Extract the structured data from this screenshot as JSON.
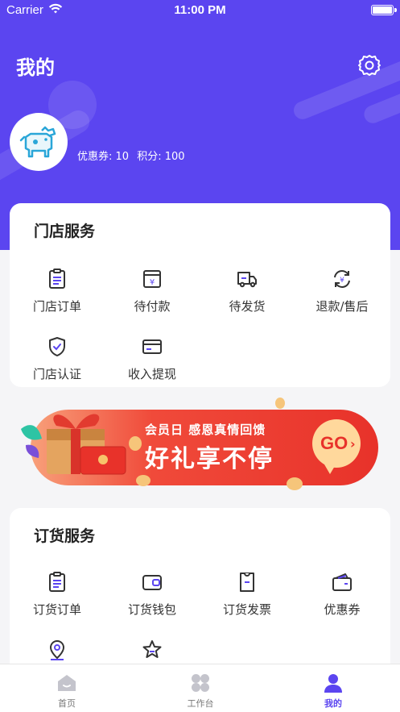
{
  "status_bar": {
    "carrier": "Carrier",
    "time": "11:00 PM"
  },
  "header": {
    "title": "我的"
  },
  "profile": {
    "coupons": "优惠券: 10",
    "points": "积分: 100"
  },
  "store_services": {
    "title": "门店服务",
    "items": [
      {
        "label": "门店订单",
        "icon": "clipboard-icon"
      },
      {
        "label": "待付款",
        "icon": "yen-card-icon"
      },
      {
        "label": "待发货",
        "icon": "truck-icon"
      },
      {
        "label": "退款/售后",
        "icon": "refund-icon"
      },
      {
        "label": "门店认证",
        "icon": "shield-check-icon"
      },
      {
        "label": "收入提现",
        "icon": "credit-card-icon"
      }
    ]
  },
  "banner": {
    "line1": "会员日 感恩真情回馈",
    "line2": "好礼享不停",
    "go": "GO"
  },
  "order_services": {
    "title": "订货服务",
    "items": [
      {
        "label": "订货订单",
        "icon": "clipboard-icon"
      },
      {
        "label": "订货钱包",
        "icon": "wallet-icon"
      },
      {
        "label": "订货发票",
        "icon": "invoice-icon"
      },
      {
        "label": "优惠券",
        "icon": "coupon-wallet-icon"
      },
      {
        "label": "",
        "icon": "location-icon"
      },
      {
        "label": "",
        "icon": "star-icon"
      }
    ]
  },
  "tabs": [
    {
      "label": "首页",
      "icon": "home-icon",
      "active": false
    },
    {
      "label": "工作台",
      "icon": "grid-icon",
      "active": false
    },
    {
      "label": "我的",
      "icon": "user-icon",
      "active": true
    }
  ],
  "colors": {
    "primary": "#5b45f0",
    "banner_red": "#f0392b"
  }
}
